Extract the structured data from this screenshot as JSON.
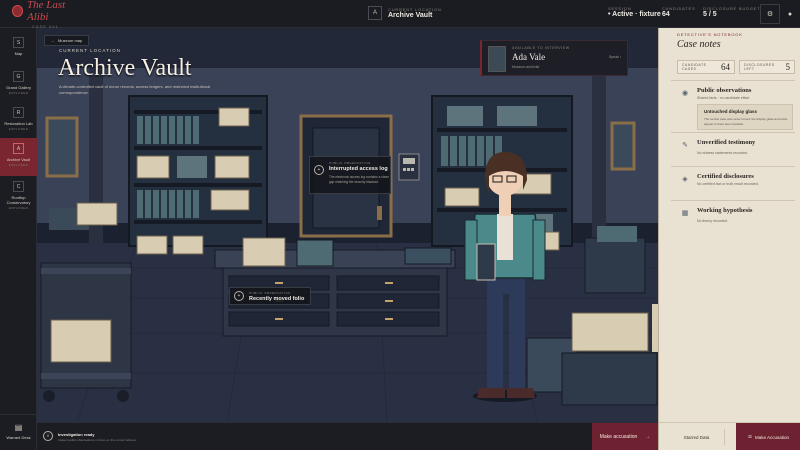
{
  "brand": {
    "title": "The Last Alibi",
    "subtitle": "CASE 001"
  },
  "header": {
    "current_location_label": "CURRENT LOCATION",
    "current_location_key": "A",
    "current_location_value": "Archive Vault",
    "session_label": "SESSION",
    "session_value": "• Active · fixture",
    "candidates_label": "CANDIDATES",
    "candidates_value": "64",
    "disclosure_label": "DISCLOSURE BUDGET",
    "disclosure_value": "5 / 5",
    "settings_icon": "gear-icon",
    "profile_icon": "user-icon"
  },
  "rail": {
    "items": [
      {
        "key": "S",
        "label": "Map",
        "sub": ""
      },
      {
        "key": "G",
        "label": "Grand Gallery",
        "sub": "EXPLORED"
      },
      {
        "key": "R",
        "label": "Restoration Lab",
        "sub": "EXPLORED"
      },
      {
        "key": "A",
        "label": "Archive Vault",
        "sub": "EXPLORED"
      },
      {
        "key": "C",
        "label": "Rooftop Conservatory",
        "sub": "EXPLORED"
      }
    ],
    "bottom_label": "Warrant Desk"
  },
  "scene": {
    "museum_map": "Museum map",
    "location_label": "CURRENT LOCATION",
    "location_title": "Archive Vault",
    "location_desc": "A climate-controlled vault of donor records, access ledgers, and restricted institutional correspondence.",
    "interview_label": "AVAILABLE TO INTERVIEW",
    "interview_name": "Ada Vale",
    "interview_role": "Museum archivist",
    "interview_action": "Speak",
    "clues": [
      {
        "label": "PUBLIC OBSERVATION",
        "title": "Interrupted access log",
        "desc": "The electronic access log contains a clean gap matching the security blackout."
      },
      {
        "label": "PUBLIC OBSERVATION",
        "title": "Recently moved folio",
        "desc": ""
      }
    ]
  },
  "notebook": {
    "kicker": "DETECTIVE'S NOTEBOOK",
    "title": "Case notes",
    "candidate_cases_label": "CANDIDATE CASES",
    "candidate_cases_value": "64",
    "disclosures_left_label": "DISCLOSURES LEFT",
    "disclosures_left_value": "5",
    "sections": [
      {
        "icon": "eye-icon",
        "title": "Public observations",
        "sub": "Shared facts · no candidate effect"
      },
      {
        "icon": "speech-icon",
        "title": "Unverified testimony",
        "sub": "No witness statements recorded."
      },
      {
        "icon": "seal-icon",
        "title": "Certified disclosures",
        "sub": "No certified fact or truth result recorded."
      },
      {
        "icon": "list-icon",
        "title": "Working hypothesis",
        "sub": "No theory recorded."
      }
    ],
    "sub_card_title": "Untouched display glass",
    "sub_card_desc": "The central case was never forced; the display glass and locks appear to have been handled."
  },
  "bottom": {
    "status_title": "Investigation ready",
    "status_desc": "Inspect public observations or focus on the current witness.",
    "accuse_label": "Make accusation",
    "starred_label": "Starred Data",
    "make_label": "Make Accusation"
  }
}
